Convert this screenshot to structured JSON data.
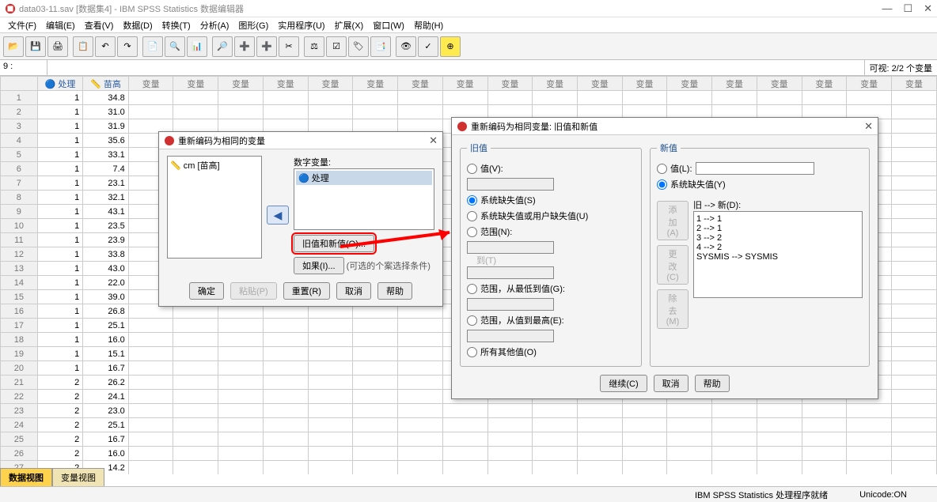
{
  "title": "data03-11.sav [数据集4] - IBM SPSS Statistics 数据编辑器",
  "menus": [
    "文件(F)",
    "编辑(E)",
    "查看(V)",
    "数据(D)",
    "转换(T)",
    "分析(A)",
    "图形(G)",
    "实用程序(U)",
    "扩展(X)",
    "窗口(W)",
    "帮助(H)"
  ],
  "cell_ref": "9 :",
  "visible_label": "可视: 2/2 个变量",
  "columns": [
    "处理",
    "苗高"
  ],
  "empty_col_label": "变量",
  "rows": [
    [
      1,
      34.8
    ],
    [
      1,
      31.0
    ],
    [
      1,
      31.9
    ],
    [
      1,
      35.6
    ],
    [
      1,
      33.1
    ],
    [
      1,
      7.4
    ],
    [
      1,
      23.1
    ],
    [
      1,
      32.1
    ],
    [
      1,
      43.1
    ],
    [
      1,
      23.5
    ],
    [
      1,
      23.9
    ],
    [
      1,
      33.8
    ],
    [
      1,
      43.0
    ],
    [
      1,
      22.0
    ],
    [
      1,
      39.0
    ],
    [
      1,
      26.8
    ],
    [
      1,
      25.1
    ],
    [
      1,
      16.0
    ],
    [
      1,
      15.1
    ],
    [
      1,
      16.7
    ],
    [
      2,
      26.2
    ],
    [
      2,
      24.1
    ],
    [
      2,
      23.0
    ],
    [
      2,
      25.1
    ],
    [
      2,
      16.7
    ],
    [
      2,
      16.0
    ],
    [
      2,
      14.2
    ]
  ],
  "dialog1": {
    "title": "重新编码为相同的变量",
    "left_var": "cm [苗高]",
    "right_label": "数字变量:",
    "right_var": "处理",
    "btn_old_new": "旧值和新值(O)...",
    "btn_if": "如果(I)...",
    "if_desc": "(可选的个案选择条件)",
    "buttons": [
      "确定",
      "粘贴(P)",
      "重置(R)",
      "取消",
      "帮助"
    ]
  },
  "dialog2": {
    "title": "重新编码为相同变量: 旧值和新值",
    "old_group": "旧值",
    "opt_value": "值(V):",
    "opt_sysmis": "系统缺失值(S)",
    "opt_sysusermis": "系统缺失值或用户缺失值(U)",
    "opt_range": "范围(N):",
    "range_to": "到(T)",
    "opt_range_lowest": "范围，从最低到值(G):",
    "opt_range_highest": "范围，从值到最高(E):",
    "opt_all_other": "所有其他值(O)",
    "new_group": "新值",
    "newopt_value": "值(L):",
    "newopt_sysmis": "系统缺失值(Y)",
    "mapping_label": "旧 --> 新(D):",
    "mappings": [
      "1 --> 1",
      "2 --> 1",
      "3 --> 2",
      "4 --> 2",
      "SYSMIS --> SYSMIS"
    ],
    "btn_add": "添加(A)",
    "btn_change": "更改(C)",
    "btn_remove": "除去(M)",
    "buttons": [
      "继续(C)",
      "取消",
      "帮助"
    ]
  },
  "bottom_tabs": {
    "data_view": "数据视图",
    "variable_view": "变量视图"
  },
  "status": {
    "ready": "IBM SPSS Statistics 处理程序就绪",
    "unicode": "Unicode:ON"
  }
}
